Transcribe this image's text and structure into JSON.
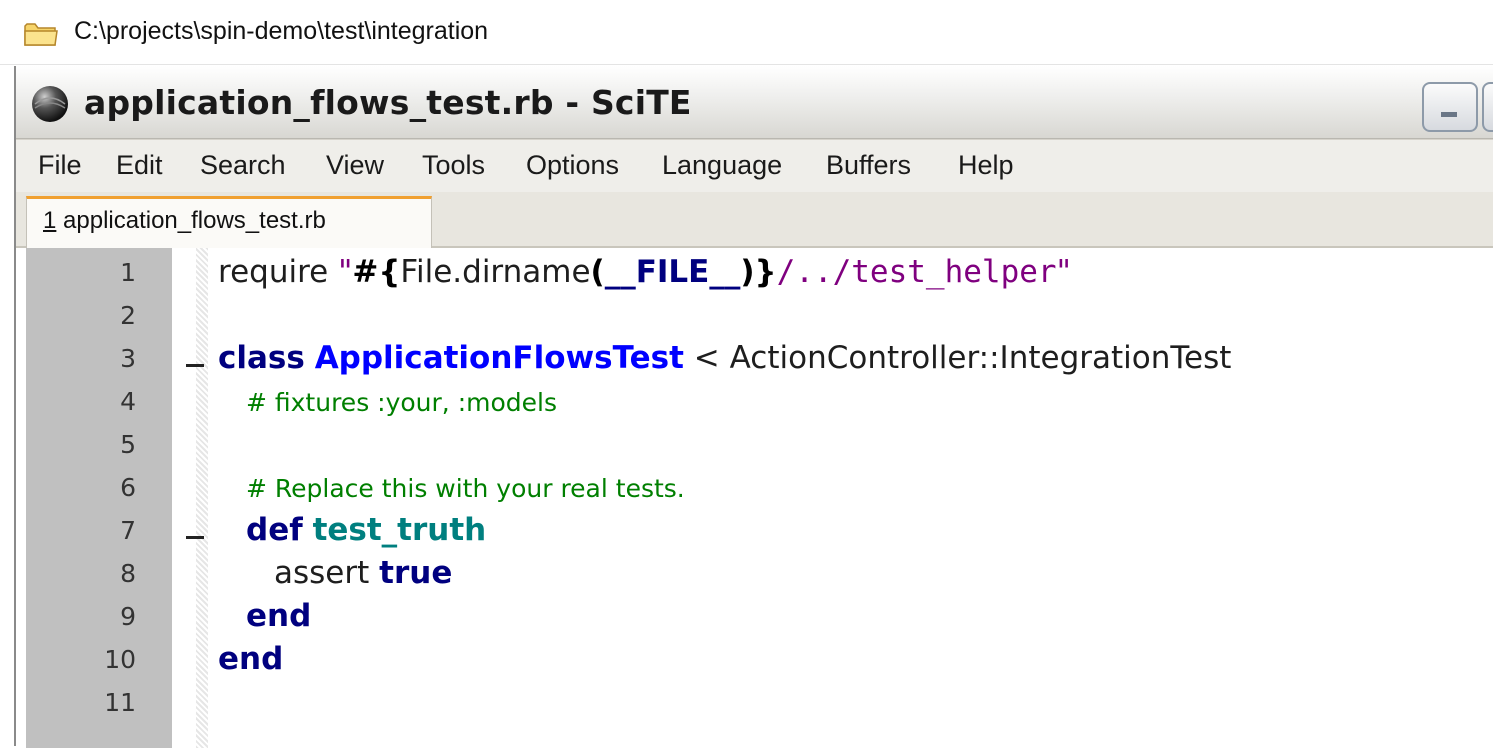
{
  "path_bar": {
    "path": "C:\\projects\\spin-demo\\test\\integration",
    "icon": "folder-icon"
  },
  "window": {
    "title": "application_flows_test.rb - SciTE",
    "app_icon": "scite-icon",
    "menu": [
      "File",
      "Edit",
      "Search",
      "View",
      "Tools",
      "Options",
      "Language",
      "Buffers",
      "Help"
    ],
    "tabs": [
      {
        "index": "1",
        "label": " application_flows_test.rb"
      }
    ]
  },
  "editor": {
    "line_numbers": [
      "1",
      "2",
      "3",
      "4",
      "5",
      "6",
      "7",
      "8",
      "9",
      "10",
      "11"
    ],
    "lines": {
      "l1": {
        "require": "require ",
        "q1": "\"",
        "hash": "#",
        "brace_open": "{",
        "file": "File",
        "dot": ".",
        "dirname": "dirname",
        "paren_open": "(",
        "file_const": "__FILE__",
        "paren_close": ")",
        "brace_close": "}",
        "rest": "/../test_helper",
        "q2": "\""
      },
      "l3": {
        "class_kw": "class",
        "class_name": "ApplicationFlowsTest",
        "lt": "<",
        "parent": "ActionController::IntegrationTest"
      },
      "l4": {
        "comment": "# fixtures :your, :models"
      },
      "l6": {
        "comment": "# Replace this with your real tests."
      },
      "l7": {
        "def_kw": "def",
        "method": "test_truth"
      },
      "l8": {
        "assert": "assert",
        "true_kw": "true"
      },
      "l9": {
        "end_kw": "end"
      },
      "l10": {
        "end_kw": "end"
      }
    }
  },
  "colors": {
    "keyword": "#00007f",
    "class_name": "#0000ff",
    "method_name": "#007f7f",
    "string": "#7f007f",
    "comment": "#007f00",
    "gutter": "#c0c0c0",
    "tab_accent": "#f0a030"
  }
}
